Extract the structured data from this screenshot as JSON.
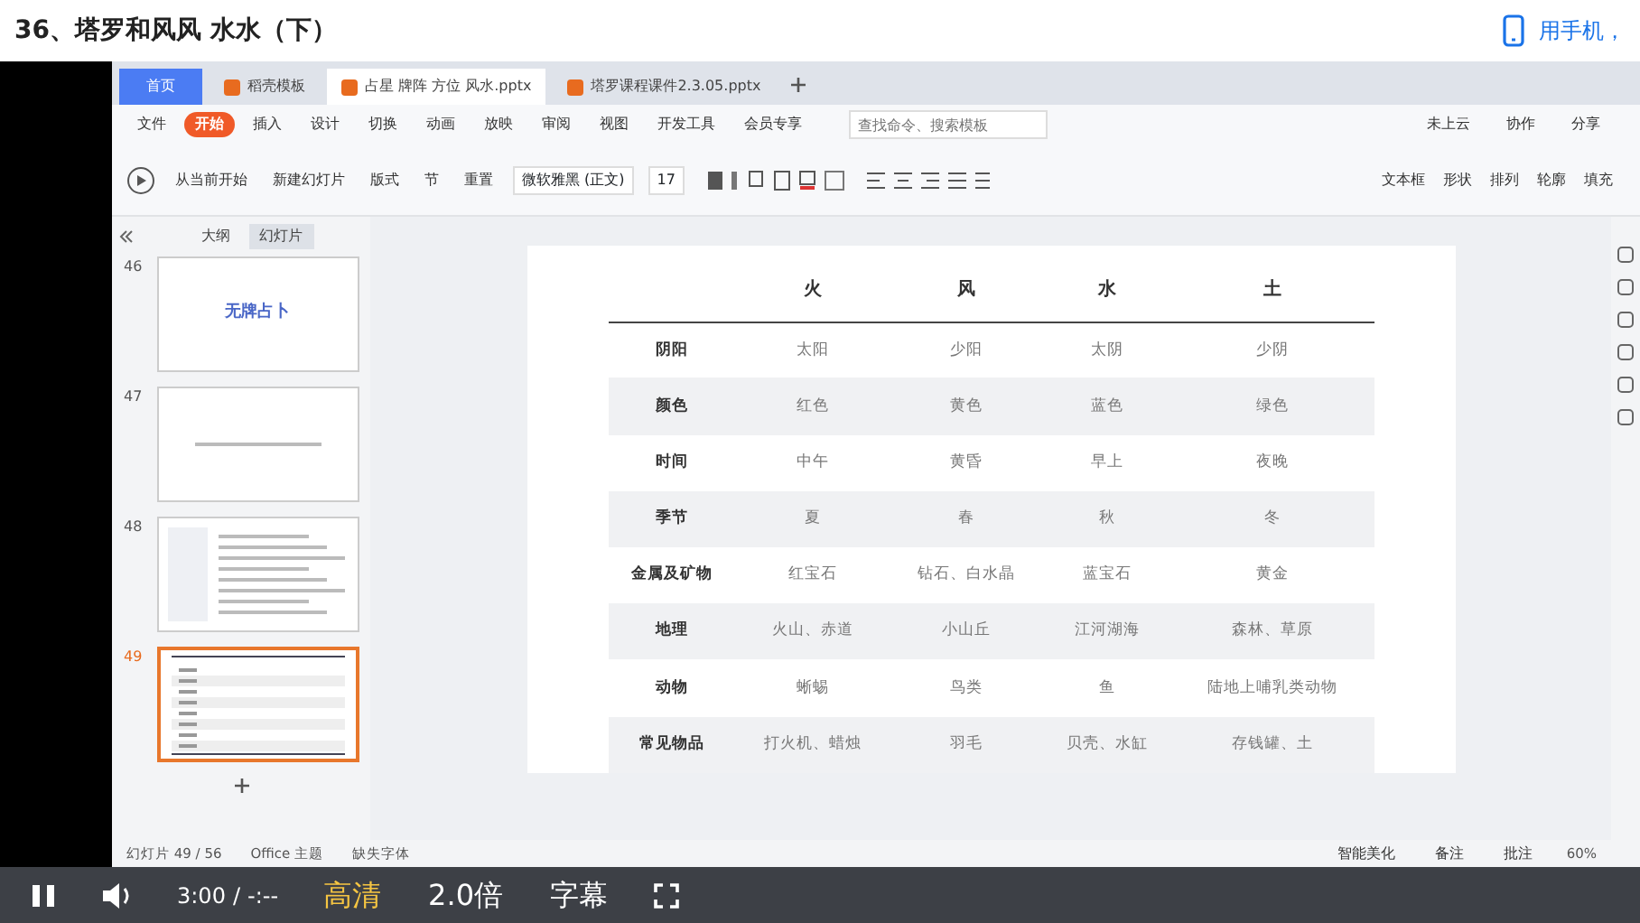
{
  "page_title": "36、塔罗和风风 水水（下）",
  "header_link": "用手机，",
  "app": {
    "tabs": [
      {
        "label": "首页",
        "kind": "home",
        "selected": false
      },
      {
        "label": "稻壳模板",
        "kind": "doc",
        "selected": false
      },
      {
        "label": "占星 牌阵 方位 风水.pptx",
        "kind": "doc",
        "selected": true
      },
      {
        "label": "塔罗课程课件2.3.05.pptx",
        "kind": "doc",
        "selected": false
      }
    ],
    "menu": [
      {
        "label": "文件",
        "selected": false
      },
      {
        "label": "开始",
        "selected": true
      },
      {
        "label": "插入",
        "selected": false
      },
      {
        "label": "设计",
        "selected": false
      },
      {
        "label": "切换",
        "selected": false
      },
      {
        "label": "动画",
        "selected": false
      },
      {
        "label": "放映",
        "selected": false
      },
      {
        "label": "审阅",
        "selected": false
      },
      {
        "label": "视图",
        "selected": false
      },
      {
        "label": "开发工具",
        "selected": false
      },
      {
        "label": "会员专享",
        "selected": false
      }
    ],
    "search": {
      "placeholder": "查找命令、搜索模板"
    },
    "menu_right": [
      "未上云",
      "协作",
      "分享"
    ],
    "ribbon_left": [
      "从当前开始",
      "新建幻灯片",
      "版式",
      "节",
      "重置"
    ],
    "font": {
      "name": "微软雅黑 (正文)",
      "size": "17"
    },
    "ribbon_right": [
      "文本框",
      "形状",
      "排列",
      "轮廓",
      "填充"
    ],
    "panel_tabs": [
      {
        "label": "大纲",
        "selected": false
      },
      {
        "label": "幻灯片",
        "selected": true
      }
    ],
    "slides": [
      {
        "number": "46",
        "kind": "title",
        "title": "无牌占卜",
        "selected": false
      },
      {
        "number": "47",
        "kind": "text",
        "selected": false
      },
      {
        "number": "48",
        "kind": "list",
        "selected": false
      },
      {
        "number": "49",
        "kind": "table",
        "selected": true
      }
    ],
    "table": {
      "columns": [
        "火",
        "风",
        "水",
        "土"
      ],
      "rows": [
        {
          "header": "阴阳",
          "cells": [
            "太阳",
            "少阳",
            "太阴",
            "少阴"
          ]
        },
        {
          "header": "颜色",
          "cells": [
            "红色",
            "黄色",
            "蓝色",
            "绿色"
          ]
        },
        {
          "header": "时间",
          "cells": [
            "中午",
            "黄昏",
            "早上",
            "夜晚"
          ]
        },
        {
          "header": "季节",
          "cells": [
            "夏",
            "春",
            "秋",
            "冬"
          ]
        },
        {
          "header": "金属及矿物",
          "cells": [
            "红宝石",
            "钻石、白水晶",
            "蓝宝石",
            "黄金"
          ]
        },
        {
          "header": "地理",
          "cells": [
            "火山、赤道",
            "小山丘",
            "江河湖海",
            "森林、草原"
          ]
        },
        {
          "header": "动物",
          "cells": [
            "蜥蜴",
            "鸟类",
            "鱼",
            "陆地上哺乳类动物"
          ]
        },
        {
          "header": "常见物品",
          "cells": [
            "打火机、蜡烛",
            "羽毛",
            "贝壳、水缸",
            "存钱罐、土"
          ]
        }
      ]
    },
    "status": [
      "幻灯片 49 / 56",
      "Office 主题",
      "缺失字体"
    ],
    "status_right": [
      "智能美化",
      "备注",
      "批注"
    ],
    "zoom": "60%"
  },
  "player": {
    "playing": true,
    "time": "3:00",
    "separator": "/",
    "duration": "-:--",
    "quality": "高清",
    "speed": "2.0倍",
    "subtitles": "字幕"
  }
}
